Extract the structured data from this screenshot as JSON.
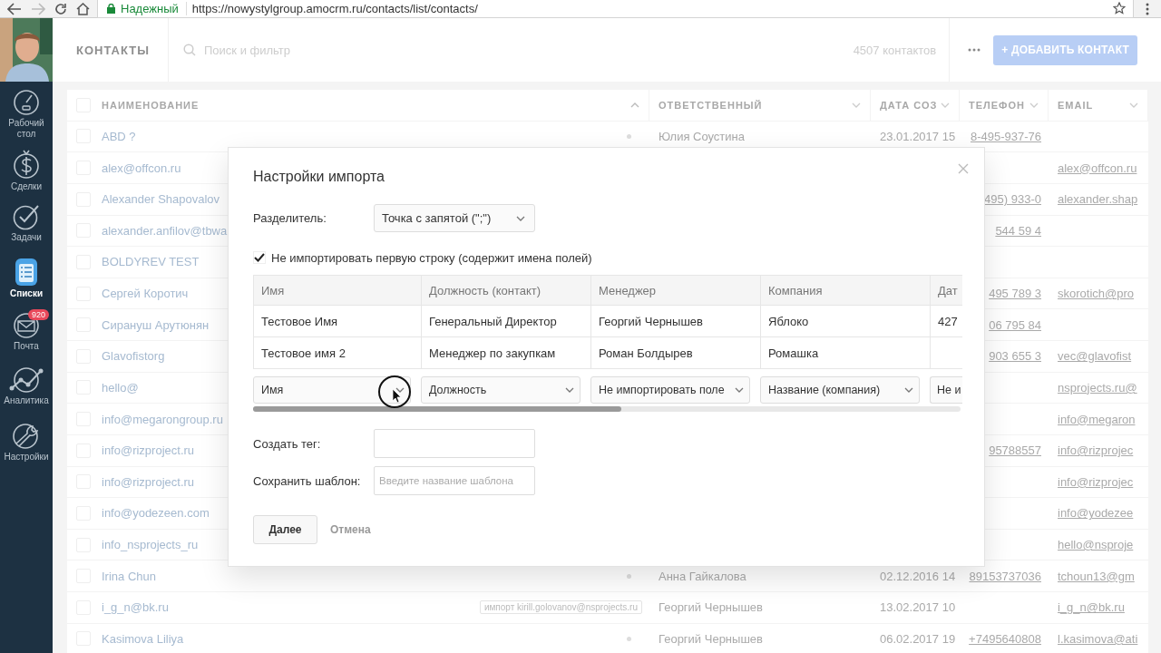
{
  "browser": {
    "security_label": "Надежный",
    "url": "https://nowystylgroup.amocrm.ru/contacts/list/contacts/"
  },
  "sidebar": {
    "items": [
      {
        "label": "Рабочий стол",
        "selected": false
      },
      {
        "label": "Сделки",
        "selected": false
      },
      {
        "label": "Задачи",
        "selected": false
      },
      {
        "label": "Списки",
        "selected": true
      },
      {
        "label": "Почта",
        "selected": false,
        "badge": "920"
      },
      {
        "label": "Аналитика",
        "selected": false
      },
      {
        "label": "Настройки",
        "selected": false
      }
    ]
  },
  "header": {
    "title": "КОНТАКТЫ",
    "search_placeholder": "Поиск и фильтр",
    "count": "4507 контактов",
    "add_button": "+ ДОБАВИТЬ КОНТАКТ"
  },
  "table": {
    "select_all_checked": false,
    "columns": [
      {
        "label": "НАИМЕНОВАНИЕ",
        "sorted": true
      },
      {
        "label": "ОТВЕТСТВЕННЫЙ",
        "sorted": false
      },
      {
        "label": "ДАТА СОЗ",
        "sorted": false
      },
      {
        "label": "ТЕЛЕФОН",
        "sorted": false
      },
      {
        "label": "EMAIL",
        "sorted": false
      }
    ],
    "rows": [
      {
        "checked": false,
        "name": "ABD ?",
        "responsible": "Юлия Соустина",
        "created": "23.01.2017 15",
        "phone": "8-495-937-76"
      },
      {
        "checked": false,
        "name": "alex@offcon.ru",
        "email": "alex@offcon.ru"
      },
      {
        "checked": false,
        "name": "Alexander Shapovalov",
        "phone": "495) 933-0",
        "email": "alexander.shap"
      },
      {
        "checked": false,
        "name": "alexander.anfilov@tbwa",
        "phone": "544 59 4"
      },
      {
        "checked": false,
        "name": "BOLDYREV TEST"
      },
      {
        "checked": false,
        "name": "Сергей Коротич",
        "phone": "495 789 3",
        "email": "skorotich@pro"
      },
      {
        "checked": false,
        "name": "Сирануш Арутюнян",
        "phone": "06 795 84"
      },
      {
        "checked": false,
        "name": "Glavofistorg",
        "phone": "903 655 3",
        "email": "vec@glavofist"
      },
      {
        "checked": false,
        "name": "hello@",
        "email": "nsprojects.ru@"
      },
      {
        "checked": false,
        "name": "info@megarongroup.ru",
        "email": "info@megaron"
      },
      {
        "checked": false,
        "name": "info@rizproject.ru",
        "phone": "95788557",
        "email": "info@rizprojec"
      },
      {
        "checked": false,
        "name": "info@rizproject.ru",
        "email": "info@rizprojec"
      },
      {
        "checked": false,
        "name": "info@yodezeen.com",
        "email": "info@yodezee"
      },
      {
        "checked": false,
        "name": "info_nsprojects_ru",
        "email": "hello@nsproje"
      },
      {
        "checked": false,
        "name": "Irina Chun",
        "responsible": "Анна Гайкалова",
        "created": "02.12.2016 14",
        "phone": "89153737036",
        "email": "tchoun13@gm"
      },
      {
        "checked": false,
        "name": "i_g_n@bk.ru",
        "tag": "импорт kirill.golovanov@nsprojects.ru",
        "responsible": "Георгий Чернышев",
        "created": "13.02.2017 10",
        "email": "i_g_n@bk.ru"
      },
      {
        "checked": false,
        "name": "Kasimova Liliya",
        "responsible": "Георгий Чернышев",
        "created": "06.02.2017 19",
        "phone": "+7495640808",
        "email": "l.kasimova@ati"
      }
    ]
  },
  "dialog": {
    "title": "Настройки импорта",
    "separator": {
      "label": "Разделитель:",
      "value": "Точка с запятой (\";\")"
    },
    "skip_first_row": {
      "label": "Не импортировать первую строку (содержит имена полей)",
      "checked": true
    },
    "preview": {
      "columns": [
        "Имя",
        "Должность (контакт)",
        "Менеджер",
        "Компания",
        "Дат"
      ],
      "rows": [
        [
          "Тестовое Имя",
          "Генеральный Директор",
          "Георгий Чернышев",
          "Яблоко",
          "427"
        ],
        [
          "Тестовое имя 2",
          "Менеджер по закупкам",
          "Роман Болдырев",
          "Ромашка"
        ]
      ],
      "mappings": [
        "Имя",
        "Должность",
        "Не импортировать поле",
        "Название (компания)",
        "Не и"
      ]
    },
    "tag_field": {
      "label": "Создать тег:"
    },
    "template_field": {
      "label": "Сохранить шаблон:",
      "placeholder": "Введите название шаблона"
    },
    "next_button": "Далее",
    "cancel_link": "Отмена"
  }
}
